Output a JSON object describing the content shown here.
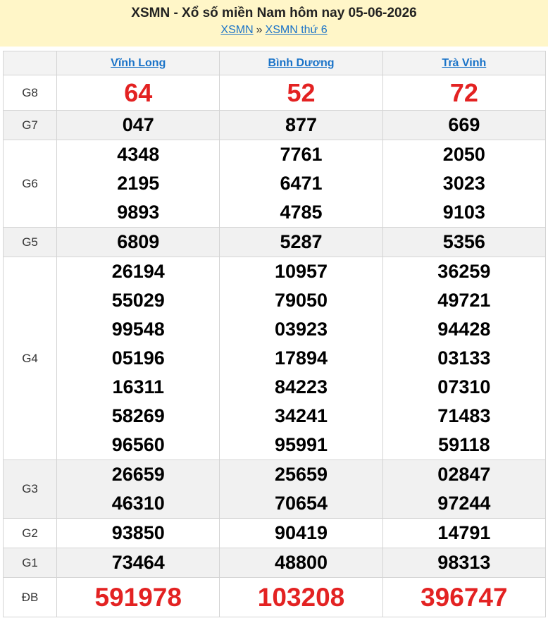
{
  "header": {
    "title": "XSMN - Xổ số miền Nam hôm nay 05-06-2026",
    "breadcrumb": [
      {
        "label": "XSMN"
      },
      {
        "label": "XSMN thứ 6"
      }
    ],
    "separator": "»"
  },
  "provinces": [
    "Vĩnh Long",
    "Bình Dương",
    "Trà Vinh"
  ],
  "prizes": [
    {
      "name": "G8",
      "values": [
        [
          "64"
        ],
        [
          "52"
        ],
        [
          "72"
        ]
      ]
    },
    {
      "name": "G7",
      "values": [
        [
          "047"
        ],
        [
          "877"
        ],
        [
          "669"
        ]
      ]
    },
    {
      "name": "G6",
      "values": [
        [
          "4348",
          "2195",
          "9893"
        ],
        [
          "7761",
          "6471",
          "4785"
        ],
        [
          "2050",
          "3023",
          "9103"
        ]
      ]
    },
    {
      "name": "G5",
      "values": [
        [
          "6809"
        ],
        [
          "5287"
        ],
        [
          "5356"
        ]
      ]
    },
    {
      "name": "G4",
      "values": [
        [
          "26194",
          "55029",
          "99548",
          "05196",
          "16311",
          "58269",
          "96560"
        ],
        [
          "10957",
          "79050",
          "03923",
          "17894",
          "84223",
          "34241",
          "95991"
        ],
        [
          "36259",
          "49721",
          "94428",
          "03133",
          "07310",
          "71483",
          "59118"
        ]
      ]
    },
    {
      "name": "G3",
      "values": [
        [
          "26659",
          "46310"
        ],
        [
          "25659",
          "70654"
        ],
        [
          "02847",
          "97244"
        ]
      ]
    },
    {
      "name": "G2",
      "values": [
        [
          "93850"
        ],
        [
          "90419"
        ],
        [
          "14791"
        ]
      ]
    },
    {
      "name": "G1",
      "values": [
        [
          "73464"
        ],
        [
          "48800"
        ],
        [
          "98313"
        ]
      ]
    },
    {
      "name": "ĐB",
      "values": [
        [
          "591978"
        ],
        [
          "103208"
        ],
        [
          "396747"
        ]
      ]
    }
  ],
  "colors": {
    "header_bg": "#fff6c8",
    "link": "#1a73c8",
    "highlight": "#e32222",
    "row_alt": "#f1f1f1"
  }
}
